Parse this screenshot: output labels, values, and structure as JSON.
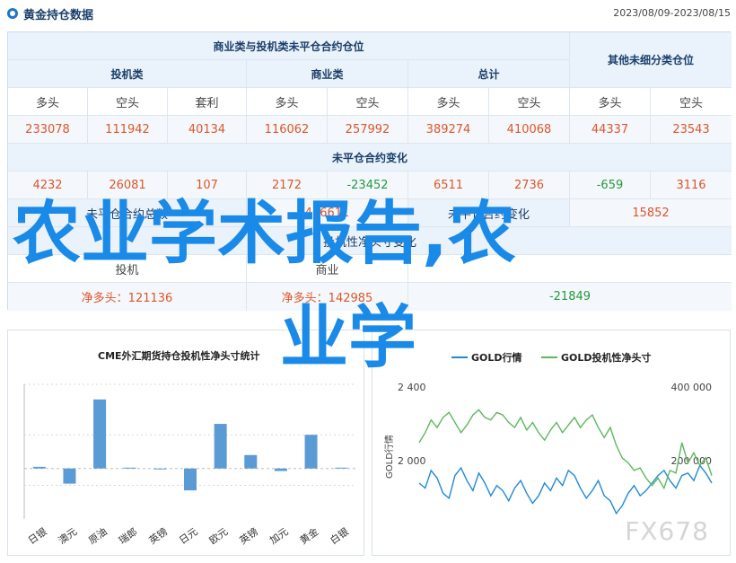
{
  "header": {
    "title": "黄金持仓数据",
    "date_range": "2023/08/09-2023/08/15"
  },
  "table": {
    "group_title": "商业类与投机类未平仓合约仓位",
    "side_title": "其他未细分类仓位",
    "groups": [
      "投机类",
      "商业类",
      "总计"
    ],
    "subheaders": [
      "多头",
      "空头",
      "套利",
      "多头",
      "空头",
      "多头",
      "空头",
      "多头",
      "空头"
    ],
    "positions": [
      "233078",
      "111942",
      "40134",
      "116062",
      "257992",
      "389274",
      "410068",
      "44337",
      "23543"
    ],
    "change_title": "未平仓合约变化",
    "changes": [
      "4232",
      "26081",
      "107",
      "2172",
      "-23452",
      "6511",
      "2736",
      "-659",
      "3116"
    ],
    "summary": {
      "oi_total_label": "未平仓合约总数",
      "oi_total_value": "436611",
      "oi_change_label": "未平仓合约变化",
      "oi_change_value": "15852",
      "net_row_label": "投机性净头寸变化",
      "spec_label": "投机",
      "commercial_label": "商业",
      "spec_net": "净多头：121136",
      "commercial_net": "净多头：142985",
      "other_net": "-21849"
    }
  },
  "overlay": {
    "line1": "农业学术报告,农",
    "line2": "业学"
  },
  "watermark": "FX678",
  "chart_data": [
    {
      "type": "bar",
      "title": "CME外汇期货持仓投机性净头寸统计",
      "categories": [
        "日银",
        "澳元",
        "原油",
        "瑞郎",
        "英镑",
        "日元",
        "欧元",
        "英镑",
        "加元",
        "黄金",
        "白银"
      ],
      "values": [
        0.2,
        -1.8,
        8.2,
        0.1,
        -0.1,
        -2.6,
        5.3,
        1.6,
        -0.3,
        4.0,
        0.1
      ],
      "ylim": [
        -6,
        10
      ],
      "grid": true
    },
    {
      "type": "line",
      "legend": [
        "GOLD行情",
        "GOLD投机性净头寸"
      ],
      "colors": [
        "#1f8ad6",
        "#5cb85c"
      ],
      "y_left": {
        "label": "GOLD行情",
        "ticks": [
          "2 400",
          "2 000"
        ]
      },
      "y_right": {
        "ticks": [
          "400 000",
          "200 000"
        ]
      },
      "series": [
        {
          "name": "GOLD行情",
          "values": [
            1960,
            1950,
            1985,
            1970,
            1940,
            1930,
            1975,
            1990,
            1965,
            1945,
            1980,
            1960,
            1935,
            1955,
            1945,
            1925,
            1950,
            1965,
            1940,
            1920,
            1935,
            1960,
            1945,
            1970,
            1955,
            1985,
            1975,
            1950,
            1930,
            1945,
            1965,
            1935,
            1925,
            1900,
            1915,
            1940,
            1955,
            1935,
            1945,
            1960,
            1975,
            1985,
            1965,
            1950,
            1975,
            1980,
            1965,
            1995,
            1980,
            1960
          ]
        },
        {
          "name": "GOLD投机性净头寸",
          "values": [
            2040,
            2060,
            2085,
            2070,
            2090,
            2100,
            2080,
            2060,
            2075,
            2095,
            2105,
            2090,
            2085,
            2100,
            2095,
            2080,
            2070,
            2090,
            2065,
            2080,
            2060,
            2045,
            2065,
            2080,
            2060,
            2075,
            2090,
            2070,
            2085,
            2095,
            2070,
            2050,
            2070,
            2035,
            2010,
            2000,
            1985,
            1990,
            1970,
            1955,
            1970,
            1950,
            1985,
            1980,
            2040,
            2000,
            2020,
            1995,
            2010,
            1975
          ]
        }
      ]
    }
  ]
}
